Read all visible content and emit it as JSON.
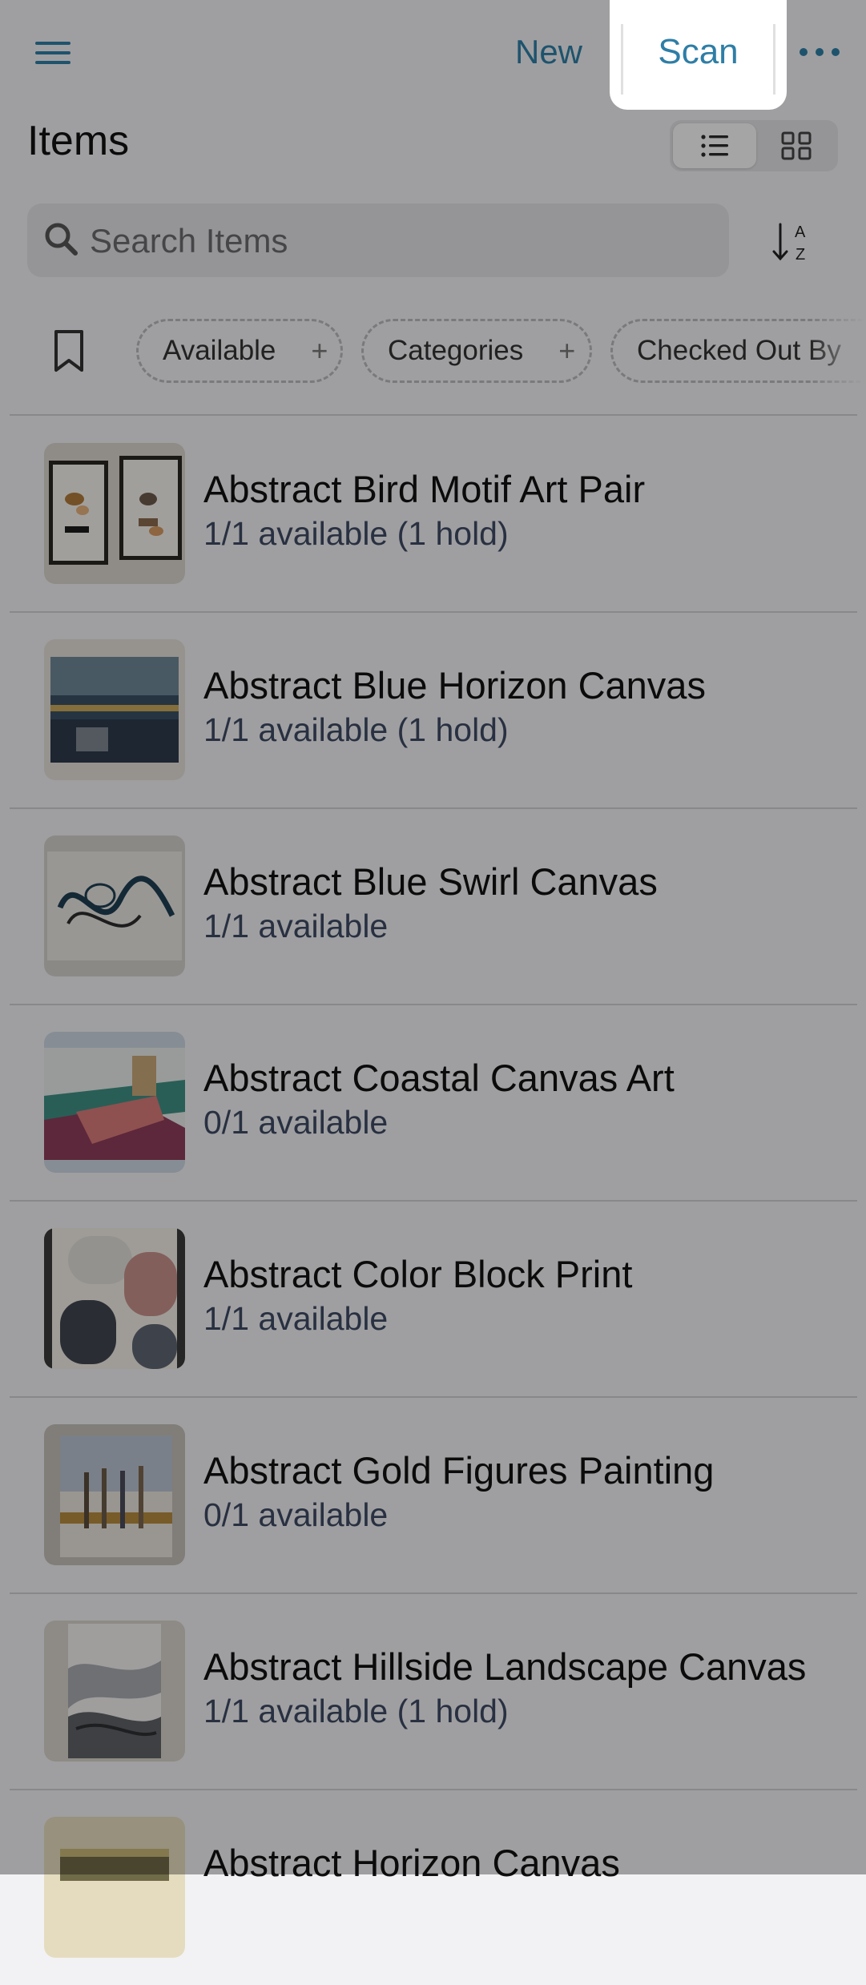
{
  "header": {
    "menu_icon": "hamburger-menu-icon",
    "new_label": "New",
    "scan_label": "Scan",
    "more_icon": "more-horizontal-icon",
    "accent": "#2e7ea6"
  },
  "page": {
    "title": "Items"
  },
  "view_toggle": {
    "list_icon": "list-view-icon",
    "grid_icon": "grid-view-icon",
    "selected": "list"
  },
  "search": {
    "placeholder": "Search Items",
    "icon": "search-icon"
  },
  "sort": {
    "icon": "sort-alpha-icon"
  },
  "filters": {
    "bookmark_icon": "bookmark-icon",
    "chips": [
      {
        "label": "Available",
        "plus": "+"
      },
      {
        "label": "Categories",
        "plus": "+"
      },
      {
        "label": "Checked Out By"
      }
    ]
  },
  "items": [
    {
      "title": "Abstract Bird Motif Art Pair",
      "status": "1/1 available (1 hold)"
    },
    {
      "title": "Abstract Blue Horizon Canvas",
      "status": "1/1 available (1 hold)"
    },
    {
      "title": "Abstract Blue Swirl Canvas",
      "status": "1/1 available"
    },
    {
      "title": "Abstract Coastal Canvas Art",
      "status": "0/1 available"
    },
    {
      "title": "Abstract Color Block Print",
      "status": "1/1 available"
    },
    {
      "title": "Abstract Gold Figures Painting",
      "status": "0/1 available"
    },
    {
      "title": "Abstract Hillside Landscape Canvas",
      "status": "1/1 available (1 hold)"
    },
    {
      "title": "Abstract Horizon Canvas",
      "status": ""
    }
  ]
}
